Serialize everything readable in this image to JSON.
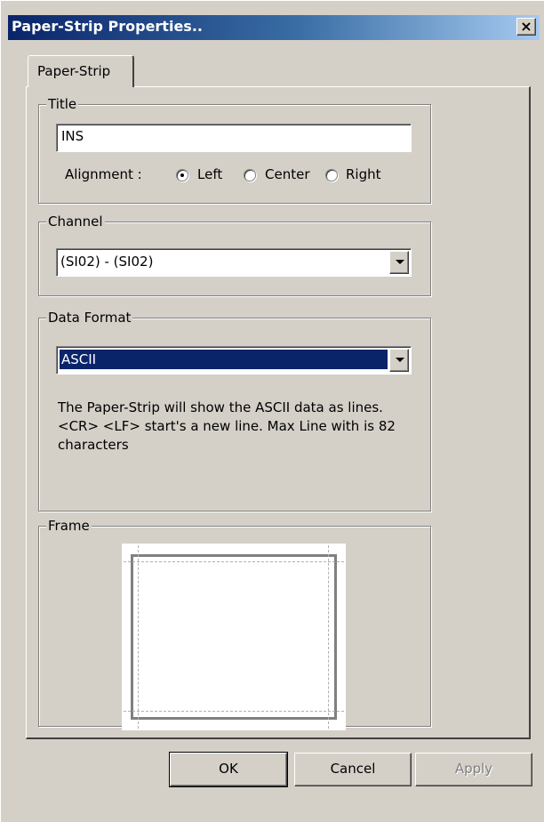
{
  "window": {
    "title": "Paper-Strip Properties..",
    "close_label": "×"
  },
  "tabs": [
    {
      "label": "Paper-Strip",
      "active": true
    }
  ],
  "title_group": {
    "legend": "Title",
    "value": "INS",
    "alignment_label": "Alignment :",
    "options": [
      {
        "label": "Left",
        "checked": true
      },
      {
        "label": "Center",
        "checked": false
      },
      {
        "label": "Right",
        "checked": false
      }
    ]
  },
  "channel_group": {
    "legend": "Channel",
    "selected": "(SI02)  - (SI02)"
  },
  "data_format_group": {
    "legend": "Data Format",
    "selected": "ASCII",
    "description": "The Paper-Strip will show the ASCII data as lines. <CR> <LF> start's a new line. Max Line with is 82 characters"
  },
  "frame_group": {
    "legend": "Frame"
  },
  "buttons": {
    "ok": "OK",
    "cancel": "Cancel",
    "apply": "Apply"
  },
  "colors": {
    "face": "#d4d0c8",
    "title_active": "#0a246a",
    "selection": "#0a246a"
  }
}
